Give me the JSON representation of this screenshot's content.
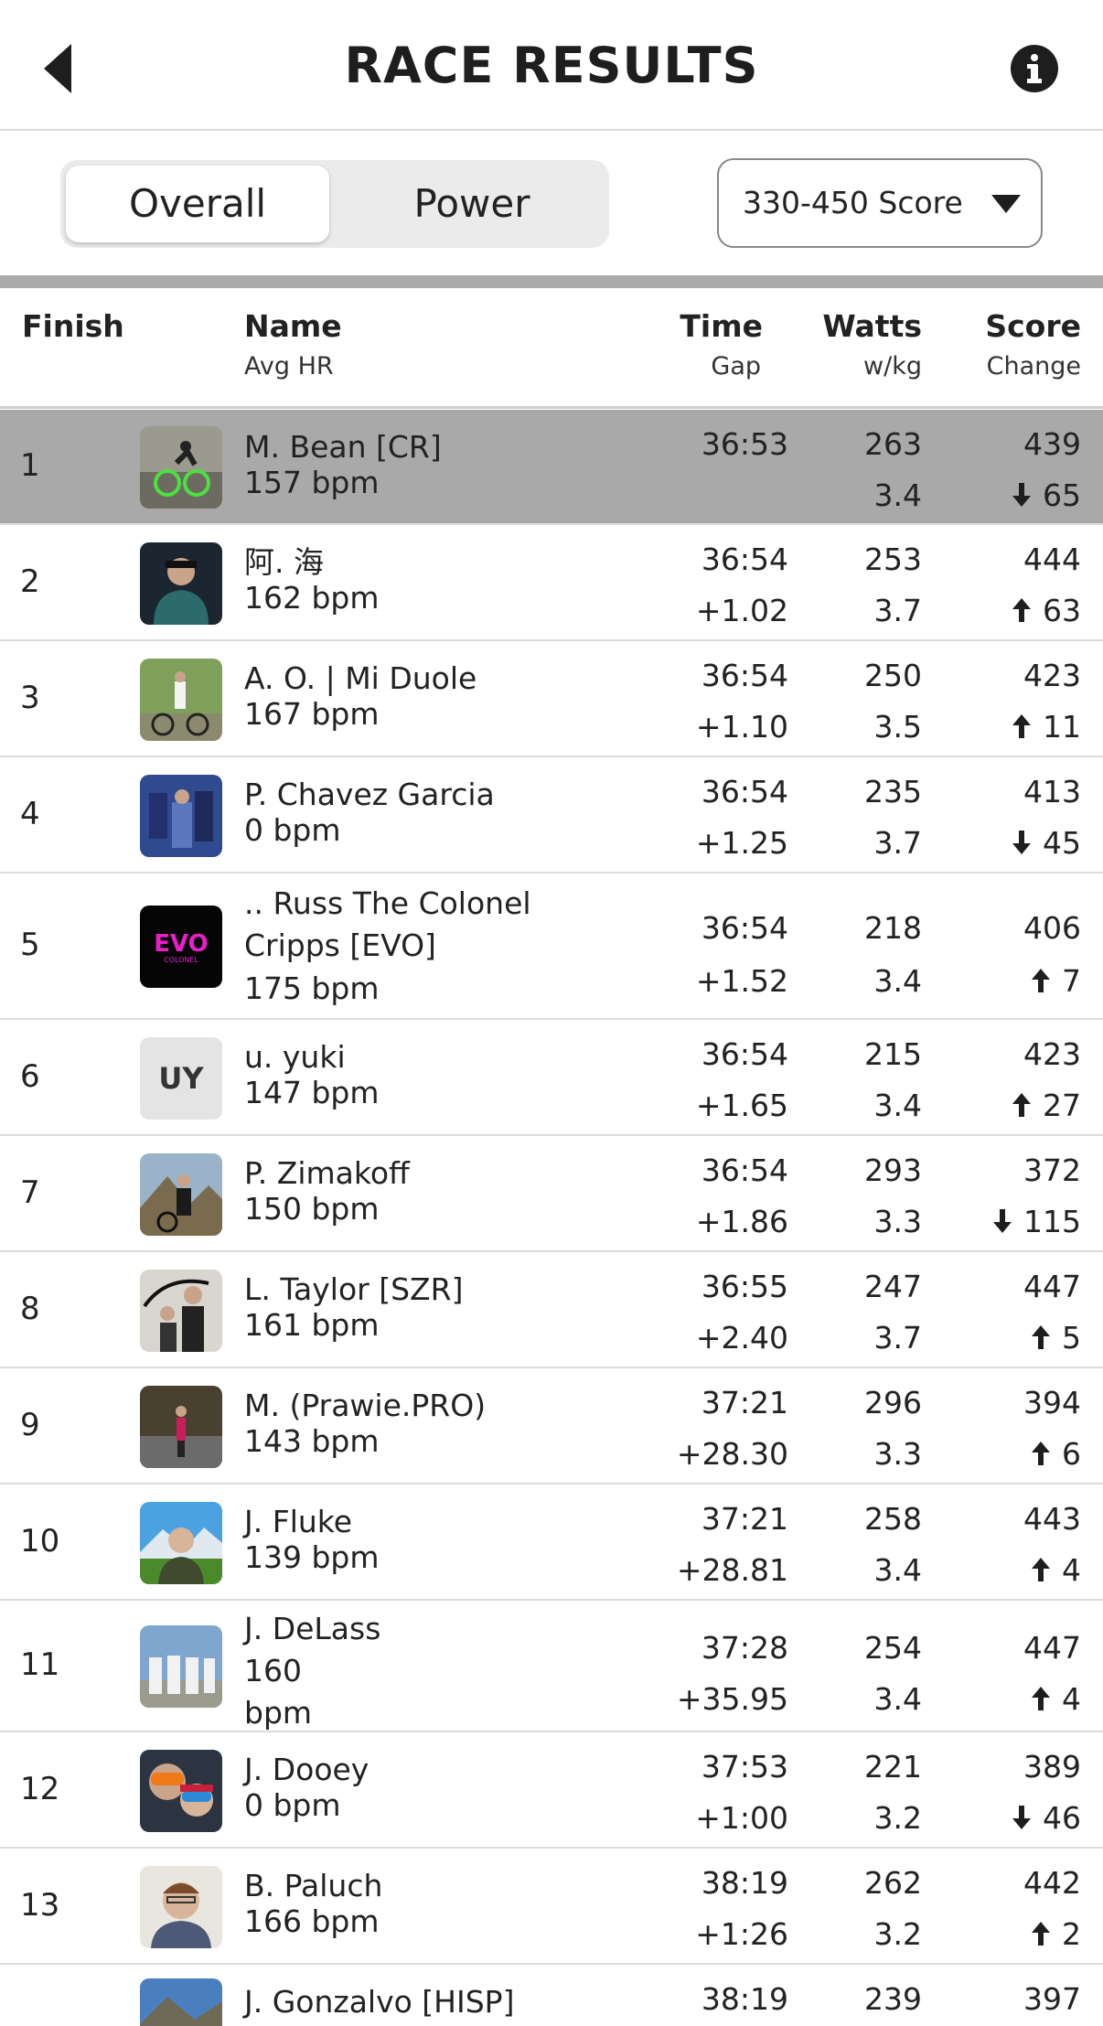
{
  "header": {
    "title": "RACE RESULTS",
    "back_icon": "back-arrow-icon",
    "info_icon": "info-icon"
  },
  "filters": {
    "tabs": [
      {
        "label": "Overall",
        "active": true
      },
      {
        "label": "Power",
        "active": false
      }
    ],
    "category": {
      "selected": "330-450 Score"
    }
  },
  "columns": {
    "finish": "Finish",
    "name": "Name",
    "name_sub": "Avg HR",
    "time": "Time",
    "time_sub": "Gap",
    "watts": "Watts",
    "watts_sub": "w/kg",
    "score": "Score",
    "score_sub": "Change"
  },
  "colors": {
    "highlight_row": "#a9a9a9",
    "accent_green": "#4ce040",
    "evo_magenta": "#e91ec9"
  },
  "riders": [
    {
      "pos": "1",
      "name": "M. Bean [CR]",
      "hr": "157 bpm",
      "time": "36:53",
      "gap": "",
      "watts": "263",
      "wkg": "3.4",
      "score": "439",
      "change": "65",
      "dir": "down",
      "avatar": "cyclist-photo",
      "highlight": true
    },
    {
      "pos": "2",
      "name": "阿. 海",
      "hr": "162 bpm",
      "time": "36:54",
      "gap": "+1.02",
      "watts": "253",
      "wkg": "3.7",
      "score": "444",
      "change": "63",
      "dir": "up",
      "avatar": "rider-photo"
    },
    {
      "pos": "3",
      "name": "A. O. | Mi Duole",
      "hr": "167 bpm",
      "time": "36:54",
      "gap": "+1.10",
      "watts": "250",
      "wkg": "3.5",
      "score": "423",
      "change": "11",
      "dir": "up",
      "avatar": "outdoor-photo"
    },
    {
      "pos": "4",
      "name": "P. Chavez Garcia",
      "hr": "0 bpm",
      "time": "36:54",
      "gap": "+1.25",
      "watts": "235",
      "wkg": "3.7",
      "score": "413",
      "change": "45",
      "dir": "down",
      "avatar": "race-photo"
    },
    {
      "pos": "5",
      "name": ".. Russ The Colonel Cripps  [EVO]",
      "hr": "175 bpm",
      "time": "36:54",
      "gap": "+1.52",
      "watts": "218",
      "wkg": "3.4",
      "score": "406",
      "change": "7",
      "dir": "up",
      "avatar": "evo-logo",
      "avatar_text": "EVO",
      "avatar_subtext": "COLONEL"
    },
    {
      "pos": "6",
      "name": "u. yuki",
      "hr": "147 bpm",
      "time": "36:54",
      "gap": "+1.65",
      "watts": "215",
      "wkg": "3.4",
      "score": "423",
      "change": "27",
      "dir": "up",
      "avatar": "initials",
      "initials": "UY"
    },
    {
      "pos": "7",
      "name": "P. Zimakoff",
      "hr": "150 bpm",
      "time": "36:54",
      "gap": "+1.86",
      "watts": "293",
      "wkg": "3.3",
      "score": "372",
      "change": "115",
      "dir": "down",
      "avatar": "mountain-photo"
    },
    {
      "pos": "8",
      "name": "L. Taylor [SZR]",
      "hr": "161 bpm",
      "time": "36:55",
      "gap": "+2.40",
      "watts": "247",
      "wkg": "3.7",
      "score": "447",
      "change": "5",
      "dir": "up",
      "avatar": "people-photo"
    },
    {
      "pos": "9",
      "name": "M.  (Prawie.PRO)",
      "hr": "143 bpm",
      "time": "37:21",
      "gap": "+28.30",
      "watts": "296",
      "wkg": "3.3",
      "score": "394",
      "change": "6",
      "dir": "up",
      "avatar": "road-photo"
    },
    {
      "pos": "10",
      "name": "J. Fluke",
      "hr": "139 bpm",
      "time": "37:21",
      "gap": "+28.81",
      "watts": "258",
      "wkg": "3.4",
      "score": "443",
      "change": "4",
      "dir": "up",
      "avatar": "portrait-photo"
    },
    {
      "pos": "11",
      "name": "J. DeLass",
      "hr": "160 bpm",
      "time": "37:28",
      "gap": "+35.95",
      "watts": "254",
      "wkg": "3.4",
      "score": "447",
      "change": "4",
      "dir": "up",
      "avatar": "team-photo"
    },
    {
      "pos": "12",
      "name": "J. Dooey",
      "hr": "0 bpm",
      "time": "37:53",
      "gap": "+1:00",
      "watts": "221",
      "wkg": "3.2",
      "score": "389",
      "change": "46",
      "dir": "down",
      "avatar": "goggles-photo"
    },
    {
      "pos": "13",
      "name": "B. Paluch",
      "hr": "166 bpm",
      "time": "38:19",
      "gap": "+1:26",
      "watts": "262",
      "wkg": "3.2",
      "score": "442",
      "change": "2",
      "dir": "up",
      "avatar": "headshot-photo"
    },
    {
      "pos": "",
      "name": "J. Gonzalvo [HISP]",
      "hr": "",
      "time": "38:19",
      "gap": "",
      "watts": "239",
      "wkg": "",
      "score": "397",
      "change": "",
      "dir": "",
      "avatar": "landscape-photo"
    }
  ]
}
